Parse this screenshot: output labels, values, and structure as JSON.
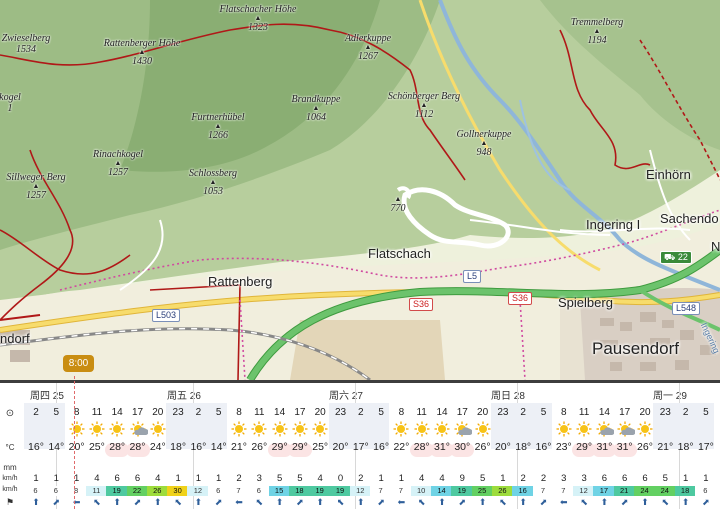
{
  "map": {
    "peaks": [
      {
        "name": "Zwieselberg",
        "elev": "1534"
      },
      {
        "name": "Rattenberger Höhe",
        "elev": "1430"
      },
      {
        "name": "Flatschacher Höhe",
        "elev": "1323"
      },
      {
        "name": "Adlerkuppe",
        "elev": "1267"
      },
      {
        "name": "Tremmelberg",
        "elev": "1194"
      },
      {
        "name": "kogel",
        "elev": "1"
      },
      {
        "name": "Brandkuppe",
        "elev": "1064"
      },
      {
        "name": "Schönberger Berg",
        "elev": "1112"
      },
      {
        "name": "Furtnerhübel",
        "elev": "1266"
      },
      {
        "name": "Gollnerkuppe",
        "elev": "948"
      },
      {
        "name": "Rinachkogel",
        "elev": "1257"
      },
      {
        "name": "Schlossberg",
        "elev": "1053"
      },
      {
        "name": "Sillweger Berg",
        "elev": "1257"
      },
      {
        "name": "",
        "elev": "770"
      }
    ],
    "towns": {
      "einhorn": "Einhörn",
      "sachendorf": "Sachendo",
      "ingering": "Ingering I",
      "flatschach": "Flatschach",
      "rattenberg": "Rattenberg",
      "spielberg": "Spielberg",
      "pausendorf": "Pausendorf",
      "ndorf": "ndorf",
      "n_edge": "N",
      "ingering_edge": "Ingering"
    },
    "shields": {
      "l503": "L503",
      "l5": "L5",
      "s36a": "S36",
      "s36b": "S36",
      "a22": "22",
      "l548": "L548"
    },
    "colors": {
      "trail": "#b01818",
      "motorway": "#4fb34f",
      "mainroad": "#f5d24a"
    }
  },
  "time_badge": "8:00",
  "labels": {
    "hour_icon": "⊙",
    "temp_unit": "°C",
    "precip_unit": "mm",
    "wind_unit": "km/h",
    "gust_unit": "km/h",
    "dir_icon": "⚑"
  },
  "days": [
    "周四 25",
    "周五 26",
    "周六 27",
    "周日 28",
    "周一 29"
  ],
  "hours": [
    "2",
    "5",
    "8",
    "11",
    "14",
    "17",
    "20",
    "23",
    "2",
    "5",
    "8",
    "11",
    "14",
    "17",
    "20",
    "23",
    "2",
    "5",
    "8",
    "11",
    "14",
    "17",
    "20",
    "23",
    "2",
    "5",
    "8",
    "11",
    "14",
    "17",
    "20",
    "23",
    "2",
    "5"
  ],
  "temps": [
    "16°",
    "14°",
    "20°",
    "25°",
    "28°",
    "28°",
    "24°",
    "18°",
    "16°",
    "14°",
    "21°",
    "26°",
    "29°",
    "29°",
    "25°",
    "20°",
    "17°",
    "16°",
    "22°",
    "28°",
    "31°",
    "30°",
    "26°",
    "20°",
    "18°",
    "16°",
    "23°",
    "29°",
    "31°",
    "31°",
    "26°",
    "21°",
    "18°",
    "17°"
  ],
  "precip": [
    "",
    "",
    "",
    "",
    "",
    "",
    "",
    "",
    "",
    "",
    "",
    "",
    "",
    "",
    "",
    "",
    "",
    "",
    "",
    "",
    "",
    "",
    "",
    "",
    "",
    "",
    "",
    "",
    "",
    "",
    "",
    "",
    "",
    ""
  ],
  "wind": [
    "1",
    "1",
    "1",
    "4",
    "6",
    "6",
    "4",
    "1",
    "1",
    "1",
    "2",
    "3",
    "5",
    "5",
    "4",
    "0",
    "2",
    "1",
    "1",
    "4",
    "4",
    "9",
    "5",
    "1",
    "2",
    "2",
    "3",
    "3",
    "6",
    "6",
    "6",
    "5",
    "1",
    "1"
  ],
  "gusts": [
    "6",
    "6",
    "8",
    "11",
    "19",
    "22",
    "26",
    "30",
    "12",
    "6",
    "7",
    "6",
    "15",
    "18",
    "19",
    "19",
    "12",
    "7",
    "7",
    "10",
    "14",
    "19",
    "25",
    "26",
    "16",
    "7",
    "7",
    "12",
    "17",
    "21",
    "24",
    "24",
    "18",
    "6"
  ],
  "weather": [
    "moon",
    "moon",
    "sun",
    "sun",
    "sun",
    "partly",
    "sun",
    "moon",
    "moon",
    "moon",
    "sun",
    "sun",
    "sun",
    "sun",
    "sun",
    "moon",
    "moon",
    "moon",
    "sun",
    "sun",
    "sun",
    "partly",
    "sun",
    "moon",
    "moon",
    "moon",
    "sun",
    "sun",
    "partly",
    "partly",
    "sun",
    "moon",
    "moon",
    "moon"
  ]
}
